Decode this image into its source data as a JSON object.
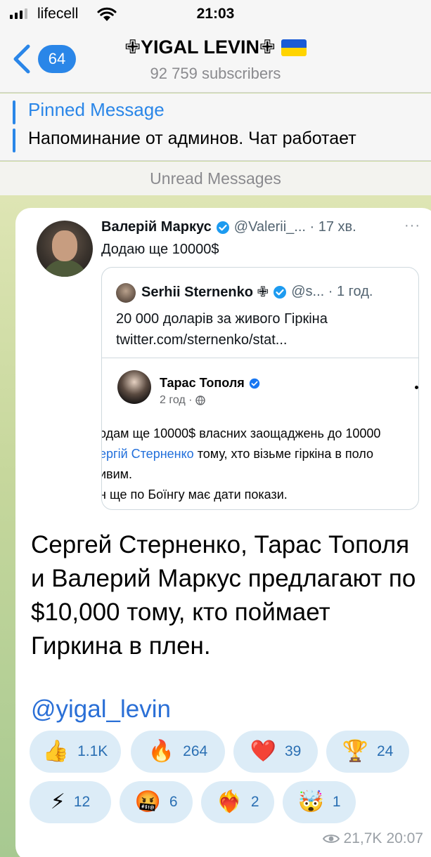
{
  "status_bar": {
    "carrier": "lifecell",
    "time": "21:03"
  },
  "header": {
    "back_count": "64",
    "channel_title": "✙YIGAL LEVIN✙",
    "subscribers": "92 759 subscribers"
  },
  "pinned": {
    "label": "Pinned Message",
    "text": "Напоминание от админов. Чат работает"
  },
  "unread_label": "Unread Messages",
  "post": {
    "tweet": {
      "author_name": "Валерій Маркус",
      "handle_time": "@Valerii_... · 17 хв.",
      "more": "···",
      "text": "Додаю ще 10000$",
      "quoted": {
        "author_name": "Serhii Sternenko ✙",
        "handle_time": "@s... · 1 год.",
        "text": "20 000 доларів за живого Гіркіна\ntwitter.com/sternenko/stat...",
        "facebook_post": {
          "author_name": "Тарас Тополя",
          "meta": "2 год ·",
          "line1": "одам ще 10000$ власних заощаджень до 10000",
          "line2_link": "ергій Стерненко",
          "line2_rest": " тому, хто візьме гіркіна в поло",
          "line3": "ивим.",
          "line4": "н ще по Боїнгу має дати покази."
        }
      }
    },
    "text": "Сергей Стерненко, Тарас Тополя и Валерий Маркус предлагают по $10,000 тому, кто поймает Гиркина в плен.",
    "signature": "@yigal_levin",
    "reactions": [
      {
        "emoji": "👍",
        "count": "1.1K"
      },
      {
        "emoji": "🔥",
        "count": "264"
      },
      {
        "emoji": "❤️",
        "count": "39"
      },
      {
        "emoji": "🏆",
        "count": "24"
      },
      {
        "emoji": "⚡",
        "count": "12"
      },
      {
        "emoji": "🤬",
        "count": "6"
      },
      {
        "emoji": "❤️‍🔥",
        "count": "2"
      },
      {
        "emoji": "🤯",
        "count": "1"
      }
    ],
    "views": "21,7K",
    "time": "20:07"
  },
  "colors": {
    "accent": "#2a86e8",
    "reaction_bg": "#dcecf7",
    "reaction_text": "#2a6fb3"
  }
}
